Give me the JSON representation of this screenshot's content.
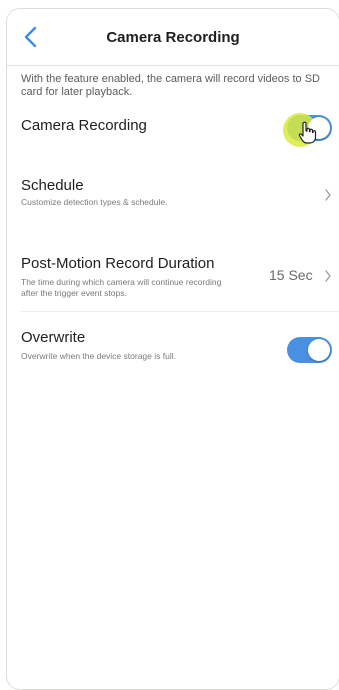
{
  "header": {
    "title": "Camera Recording"
  },
  "intro_text": "With the feature enabled, the camera will record videos to SD card for later playback.",
  "settings": {
    "camera_recording": {
      "label": "Camera Recording",
      "enabled": true
    },
    "schedule": {
      "label": "Schedule",
      "description": "Customize detection types & schedule."
    },
    "post_motion": {
      "label": "Post-Motion Record Duration",
      "description": "The time during which camera will continue recording after the trigger event stops.",
      "value": "15 Sec"
    },
    "overwrite": {
      "label": "Overwrite",
      "description": "Overwrite when the device storage is full.",
      "enabled": true
    }
  },
  "colors": {
    "accent": "#4a90e2",
    "highlight": "#daeb3c"
  },
  "icons": {
    "back": "chevron-left-icon",
    "row_arrow": "chevron-right-icon",
    "pointer": "hand-pointer-icon"
  }
}
